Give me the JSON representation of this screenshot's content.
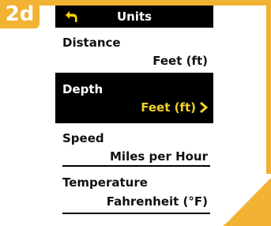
{
  "step_label": "2d",
  "header": {
    "title": "Units",
    "back_icon": "back-arrow-icon"
  },
  "rows": [
    {
      "label": "Distance",
      "value": "Feet (ft)",
      "selected": false
    },
    {
      "label": "Depth",
      "value": "Feet (ft)",
      "selected": true
    },
    {
      "label": "Speed",
      "value": "Miles per Hour",
      "selected": false
    },
    {
      "label": "Temperature",
      "value": "Fahrenheit (°F)",
      "selected": false
    }
  ],
  "colors": {
    "frame": "#f2b233",
    "highlight_text": "#f2d02a",
    "bar": "#000000"
  }
}
